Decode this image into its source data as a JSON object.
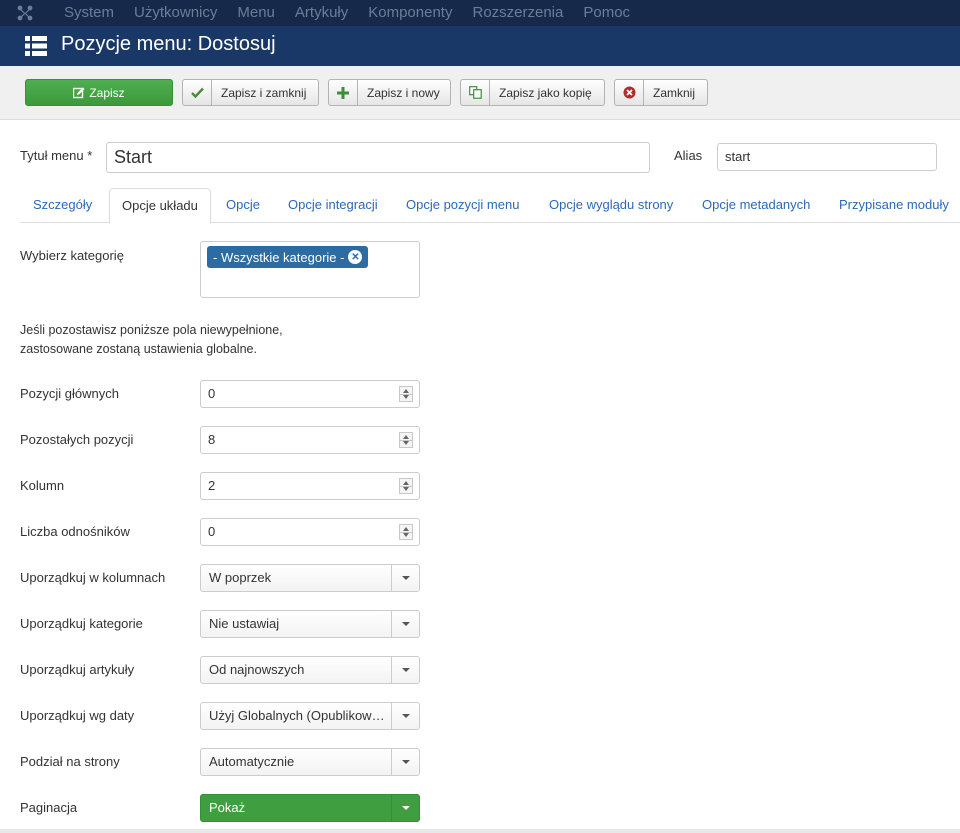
{
  "topnav": {
    "logo_icon": "joomla-logo-icon",
    "items": [
      "System",
      "Użytkownicy",
      "Menu",
      "Artykuły",
      "Komponenty",
      "Rozszerzenia",
      "Pomoc"
    ]
  },
  "titlebar": {
    "icon": "list-icon",
    "title": "Pozycje menu: Dostosuj"
  },
  "toolbar": {
    "save": "Zapisz",
    "save_close": "Zapisz i zamknij",
    "save_new": "Zapisz i nowy",
    "save_copy": "Zapisz jako kopię",
    "close": "Zamknij"
  },
  "form": {
    "title_label": "Tytuł menu *",
    "title_value": "Start",
    "alias_label": "Alias",
    "alias_value": "start"
  },
  "tabs": [
    "Szczegóły",
    "Opcje układu",
    "Opcje",
    "Opcje integracji",
    "Opcje pozycji menu",
    "Opcje wyglądu strony",
    "Opcje metadanych",
    "Przypisane moduły"
  ],
  "active_tab": "Opcje układu",
  "layout": {
    "category_label": "Wybierz kategorię",
    "category_chip": "- Wszystkie kategorie -",
    "note_line1": "Jeśli pozostawisz poniższe pola niewypełnione,",
    "note_line2": "zastosowane zostaną ustawienia globalne.",
    "fields": [
      {
        "label": "Pozycji głównych",
        "value": "0"
      },
      {
        "label": "Pozostałych pozycji",
        "value": "8"
      },
      {
        "label": "Kolumn",
        "value": "2"
      },
      {
        "label": "Liczba odnośników",
        "value": "0"
      },
      {
        "label": "Uporządkuj w kolumnach",
        "value": "W poprzek"
      },
      {
        "label": "Uporządkuj kategorie",
        "value": "Nie ustawiaj"
      },
      {
        "label": "Uporządkuj artykuły",
        "value": "Od najnowszych"
      },
      {
        "label": "Uporządkuj wg daty",
        "value": "Użyj Globalnych (Opublikowany)"
      },
      {
        "label": "Podział na strony",
        "value": "Automatycznie"
      },
      {
        "label": "Paginacja",
        "value": "Pokaż"
      }
    ]
  },
  "colors": {
    "navbar": "#17294a",
    "titlebar": "#1a3867",
    "save_green": "#46a546",
    "link_blue": "#2a69b8",
    "chip_blue": "#2d6ca2"
  }
}
